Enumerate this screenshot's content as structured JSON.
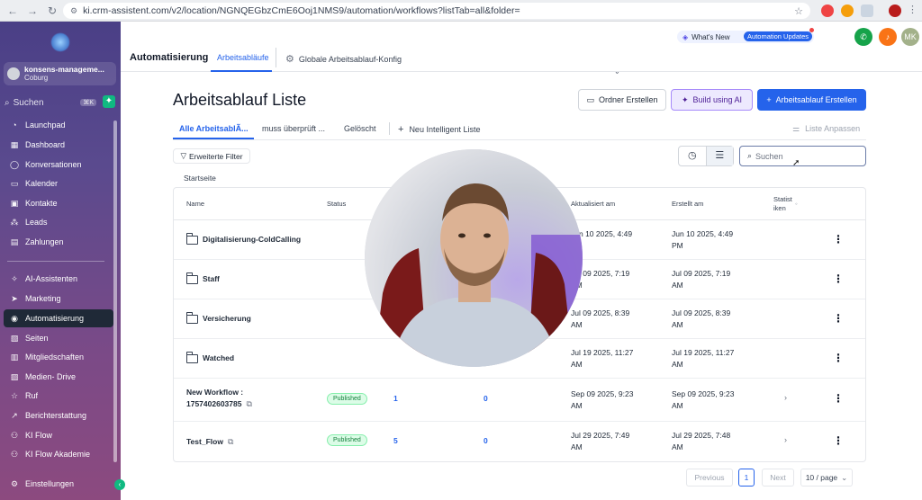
{
  "browser": {
    "url": "ki.crm-assistent.com/v2/location/NGNQEGbzCmE6Ooj1NMS9/automation/workflows?listTab=all&folder="
  },
  "sidebar": {
    "account_name": "konsens-manageme...",
    "account_location": "Coburg",
    "search_placeholder": "Suchen",
    "search_shortcut": "⌘K",
    "items": [
      {
        "label": "Launchpad",
        "icon": "rocket-icon"
      },
      {
        "label": "Dashboard",
        "icon": "dashboard-icon"
      },
      {
        "label": "Konversationen",
        "icon": "chat-icon"
      },
      {
        "label": "Kalender",
        "icon": "calendar-icon"
      },
      {
        "label": "Kontakte",
        "icon": "contacts-icon"
      },
      {
        "label": "Leads",
        "icon": "leads-icon"
      },
      {
        "label": "Zahlungen",
        "icon": "payments-icon"
      },
      {
        "label": "AI-Assistenten",
        "icon": "sparkle-icon"
      },
      {
        "label": "Marketing",
        "icon": "send-icon"
      },
      {
        "label": "Automatisierung",
        "icon": "automation-icon"
      },
      {
        "label": "Seiten",
        "icon": "pages-icon"
      },
      {
        "label": "Mitgliedschaften",
        "icon": "membership-icon"
      },
      {
        "label": "Medien- Drive",
        "icon": "media-icon"
      },
      {
        "label": "Ruf",
        "icon": "star-icon"
      },
      {
        "label": "Berichterstattung",
        "icon": "chart-icon"
      },
      {
        "label": "KI Flow",
        "icon": "flow-icon"
      },
      {
        "label": "KI Flow Akademie",
        "icon": "academy-icon"
      },
      {
        "label": "Einstellungen",
        "icon": "gear-icon"
      }
    ]
  },
  "header": {
    "title": "Automatisierung",
    "tab_workflows": "Arbeitsabläufe",
    "tab_global": "Globale Arbeitsablauf-Konfig",
    "whats_new": "What's New",
    "automation_updates": "Automation Updates",
    "user_initials": "MK"
  },
  "main": {
    "title": "Arbeitsablauf Liste",
    "btn_folder": "Ordner Erstellen",
    "btn_ai": "Build using AI",
    "btn_create": "Arbeitsablauf Erstellen",
    "tabs": [
      "Alle ArbeitsablÃ...",
      "muss überprüft ...",
      "Gelöscht"
    ],
    "new_smart_list": "Neu Intelligent Liste",
    "customize_list": "Liste Anpassen",
    "advanced_filter": "Erweiterte Filter",
    "search_placeholder": "Suchen",
    "breadcrumb": "Startseite"
  },
  "table": {
    "headers": {
      "name": "Name",
      "status": "Status",
      "updated": "Aktualisiert am",
      "created": "Erstellt am",
      "stats_line1": "Statist",
      "stats_line2": "iken"
    },
    "rows": [
      {
        "name": "Digitalisierung-ColdCalling",
        "updated_1": "Jun 10 2025, 4:49",
        "updated_2": "PM",
        "created_1": "Jun 10 2025, 4:49",
        "created_2": "PM"
      },
      {
        "name": "Staff",
        "updated_1": "Jul 09 2025, 7:19",
        "updated_2": "AM",
        "created_1": "Jul 09 2025, 7:19",
        "created_2": "AM"
      },
      {
        "name": "Versicherung",
        "updated_1": "Jul 09 2025, 8:39",
        "updated_2": "AM",
        "created_1": "Jul 09 2025, 8:39",
        "created_2": "AM"
      },
      {
        "name": "Watched",
        "updated_1": "Jul 19 2025, 11:27",
        "updated_2": "AM",
        "created_1": "Jul 19 2025, 11:27",
        "created_2": "AM"
      },
      {
        "name_1": "New Workflow :",
        "name_2": "1757402603785",
        "status": "Published",
        "col_a": "1",
        "col_b": "0",
        "updated_1": "Sep 09 2025, 9:23",
        "updated_2": "AM",
        "created_1": "Sep 09 2025, 9:23",
        "created_2": "AM"
      },
      {
        "name": "Test_Flow",
        "status": "Published",
        "col_a": "5",
        "col_b": "0",
        "updated_1": "Jul 29 2025, 7:49",
        "updated_2": "AM",
        "created_1": "Jul 29 2025, 7:48",
        "created_2": "AM"
      }
    ]
  },
  "pagination": {
    "previous": "Previous",
    "current_page": "1",
    "next": "Next",
    "page_size": "10 / page"
  },
  "colors": {
    "accent": "#2563eb",
    "published_green": "#15803d",
    "sidebar_top": "#4a3f86",
    "sidebar_bottom": "#8c4a7f"
  }
}
